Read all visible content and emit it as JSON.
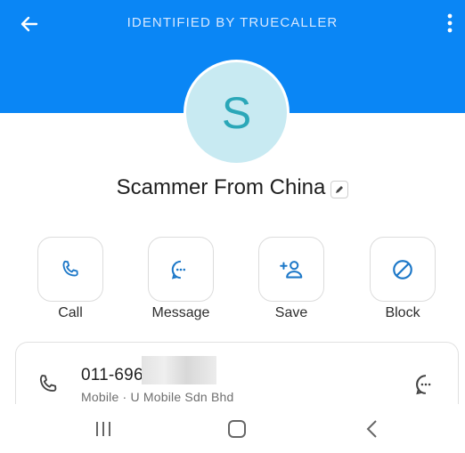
{
  "colors": {
    "header_blue": "#0a86f5",
    "accent_blue": "#1d78c8",
    "avatar_bg": "#c8eaf2",
    "avatar_letter": "#2aa7b8"
  },
  "header": {
    "title": "IDENTIFIED BY TRUECALLER",
    "back_icon": "arrow-left-icon",
    "menu_icon": "more-vertical-icon"
  },
  "contact": {
    "avatar_initial": "S",
    "name": "Scammer From China",
    "edit_icon": "pencil-icon"
  },
  "actions": [
    {
      "label": "Call",
      "icon": "phone-icon"
    },
    {
      "label": "Message",
      "icon": "chat-bubble-icon"
    },
    {
      "label": "Save",
      "icon": "add-person-icon"
    },
    {
      "label": "Block",
      "icon": "block-icon"
    }
  ],
  "number_card": {
    "number": "011-696",
    "carrier": "Mobile · U Mobile Sdn Bhd",
    "icon": "phone-icon",
    "message_icon": "chat-bubble-icon"
  },
  "nav": {
    "recents_icon": "recent-apps-icon",
    "home_icon": "home-icon",
    "back_icon": "back-chevron-icon"
  }
}
